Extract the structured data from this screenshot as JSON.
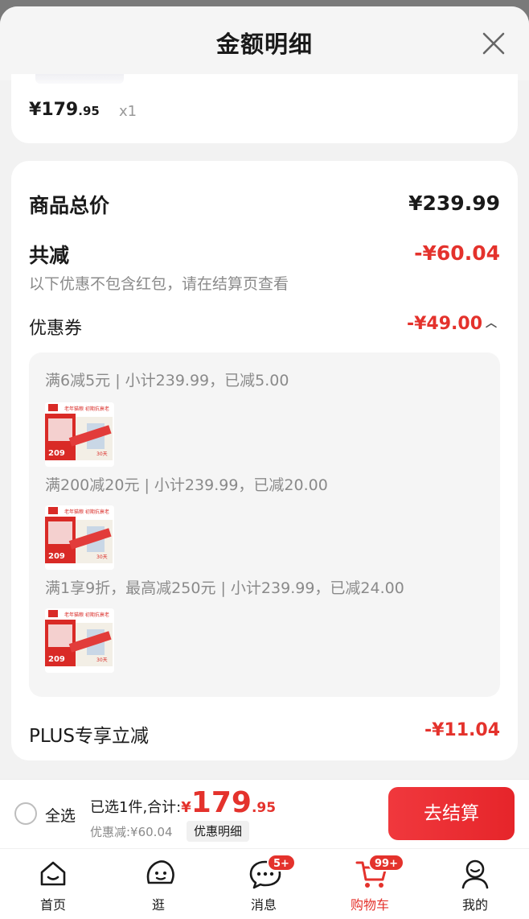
{
  "sheet": {
    "title": "金额明细"
  },
  "item": {
    "currency": "¥",
    "price_int": "179",
    "price_dec": ".95",
    "qty": "x1"
  },
  "summary": {
    "total_label": "商品总价",
    "total_value": "¥239.99",
    "discount_label": "共减",
    "discount_value": "-¥60.04",
    "hint": "以下优惠不包含红包，请在结算页查看",
    "coupon_label": "优惠券",
    "coupon_value": "-¥49.00",
    "coupon_rules": [
      {
        "text": "满6减5元 | 小计239.99，已减5.00"
      },
      {
        "text": "满200减20元 | 小计239.99，已减20.00"
      },
      {
        "text": "满1享9折，最高减250元 | 小计239.99，已减24.00"
      }
    ],
    "plus_label": "PLUS专享立减",
    "plus_value": "-¥11.04"
  },
  "thumb": {
    "brand_badge": "6/8",
    "headline": "老年猫粮 初期抗衰老",
    "price": "209",
    "days": "30天"
  },
  "bottom": {
    "select_all": "全选",
    "selected_text": "已选1件,合计:",
    "currency": "¥",
    "amount_int": "179",
    "amount_dec": ".95",
    "discount_text": "优惠减:¥60.04",
    "detail_btn": "优惠明细",
    "checkout": "去结算"
  },
  "tabs": [
    {
      "label": "首页",
      "icon": "home-icon"
    },
    {
      "label": "逛",
      "icon": "browse-icon"
    },
    {
      "label": "消息",
      "icon": "message-icon",
      "badge": "5+"
    },
    {
      "label": "购物车",
      "icon": "cart-icon",
      "badge": "99+",
      "active": true
    },
    {
      "label": "我的",
      "icon": "profile-icon"
    }
  ],
  "colors": {
    "accent": "#e4322c",
    "bg": "#f2f2f2"
  }
}
